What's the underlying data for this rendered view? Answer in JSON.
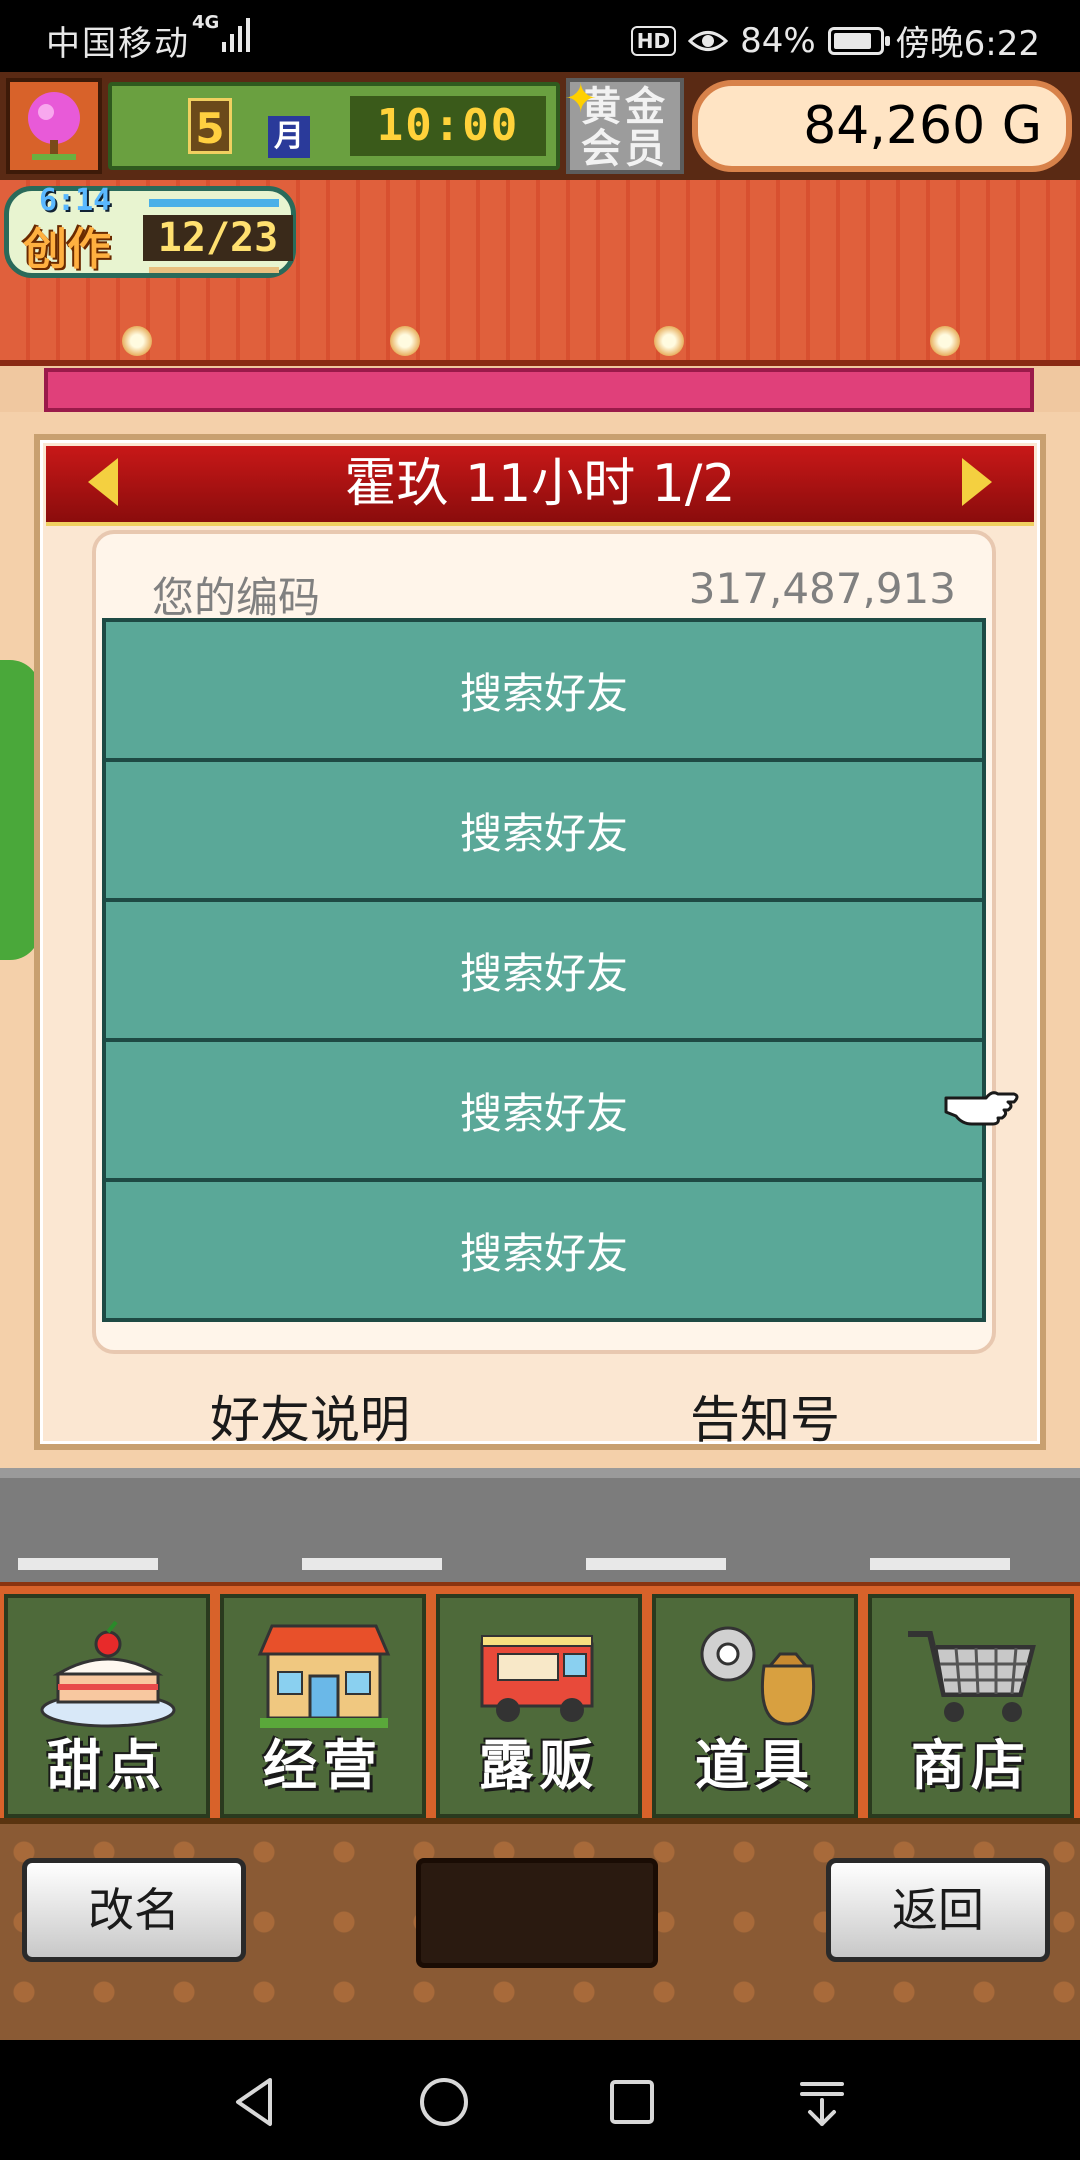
{
  "status_bar": {
    "carrier": "中国移动",
    "network": "4G",
    "hd": "HD",
    "battery": "84%",
    "battery_level": 0.84,
    "time": "傍晚6:22"
  },
  "header": {
    "month": "5",
    "month_unit": "月",
    "clock": "10:00",
    "member_label": "黄金会员",
    "money": "84,260 G"
  },
  "create_widget": {
    "time": "6:14",
    "label": "创作",
    "count": "12/23"
  },
  "friend_panel": {
    "title": "霍玖  11小时 1/2",
    "code_label": "您的编码",
    "code_value": "317,487,913",
    "slots": [
      "搜索好友",
      "搜索好友",
      "搜索好友",
      "搜索好友",
      "搜索好友"
    ],
    "footer_left": "好友说明",
    "footer_right": "告知号"
  },
  "menu": [
    {
      "label": "甜点",
      "icon": "cake-icon"
    },
    {
      "label": "经营",
      "icon": "shop-icon"
    },
    {
      "label": "露贩",
      "icon": "food-truck-icon"
    },
    {
      "label": "道具",
      "icon": "items-icon"
    },
    {
      "label": "商店",
      "icon": "cart-icon"
    }
  ],
  "actions": {
    "rename": "改名",
    "back": "返回"
  },
  "colors": {
    "header_red": "#c81818",
    "slot_teal": "#5aa898",
    "menu_green": "#4e6a3a",
    "menu_orange": "#d8622a"
  }
}
